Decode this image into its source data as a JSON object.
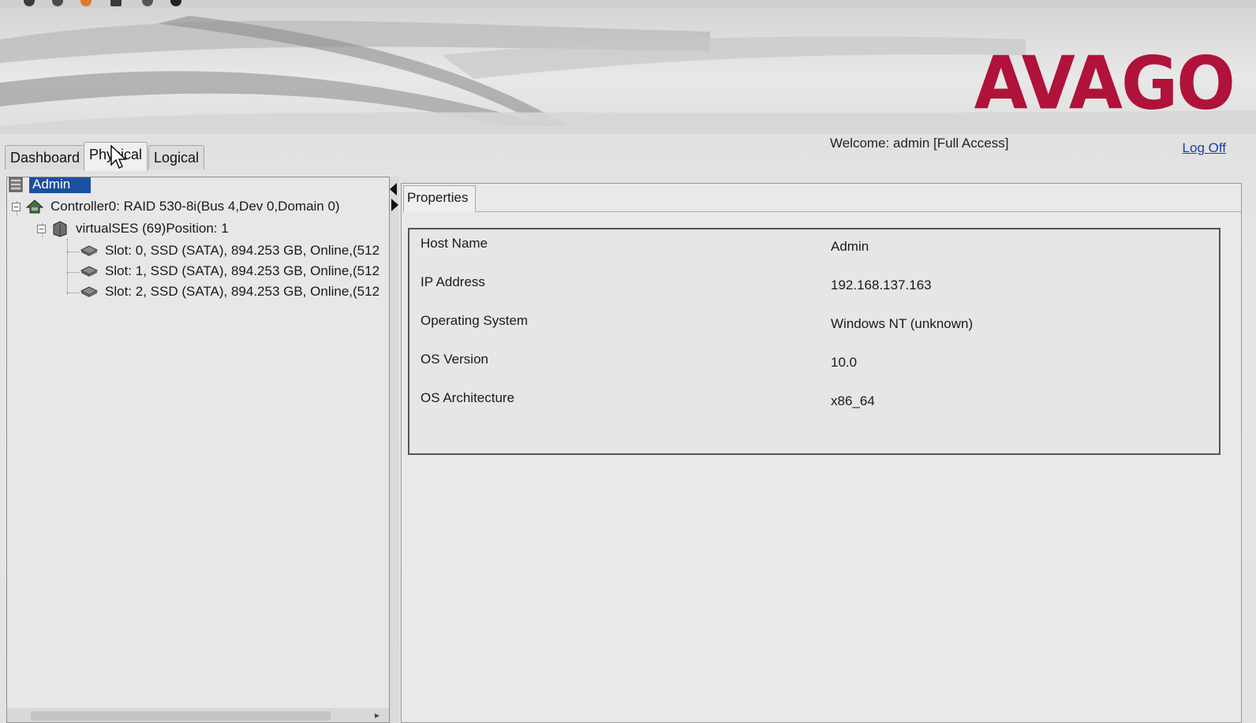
{
  "brand": {
    "logo": "AVAGO",
    "logo_color": "#b0123a"
  },
  "tabs": [
    {
      "label": "Dashboard",
      "active": false
    },
    {
      "label": "Physical",
      "active": true
    },
    {
      "label": "Logical",
      "active": false
    }
  ],
  "header": {
    "welcome": "Welcome: admin [Full Access]",
    "logoff": "Log Off"
  },
  "tree": {
    "root": "Admin",
    "controller": "Controller0: RAID 530-8i(Bus 4,Dev 0,Domain 0)",
    "enclosure": "virtualSES (69)Position: 1",
    "drives": [
      "Slot: 0, SSD  (SATA), 894.253 GB, Online,(512",
      "Slot: 1, SSD  (SATA), 894.253 GB, Online,(512",
      "Slot: 2, SSD  (SATA), 894.253 GB, Online,(512"
    ]
  },
  "properties": {
    "tab_label": "Properties",
    "rows": [
      {
        "key": "Host Name",
        "value": "Admin"
      },
      {
        "key": "IP Address",
        "value": "192.168.137.163"
      },
      {
        "key": "Operating System",
        "value": "Windows NT (unknown)"
      },
      {
        "key": "OS Version",
        "value": "10.0"
      },
      {
        "key": "OS Architecture",
        "value": "x86_64"
      }
    ]
  },
  "icons": {
    "server": "server-icon",
    "controller": "controller-icon",
    "enclosure": "enclosure-icon",
    "drive": "drive-icon",
    "cursor": "mouse-pointer-icon"
  }
}
